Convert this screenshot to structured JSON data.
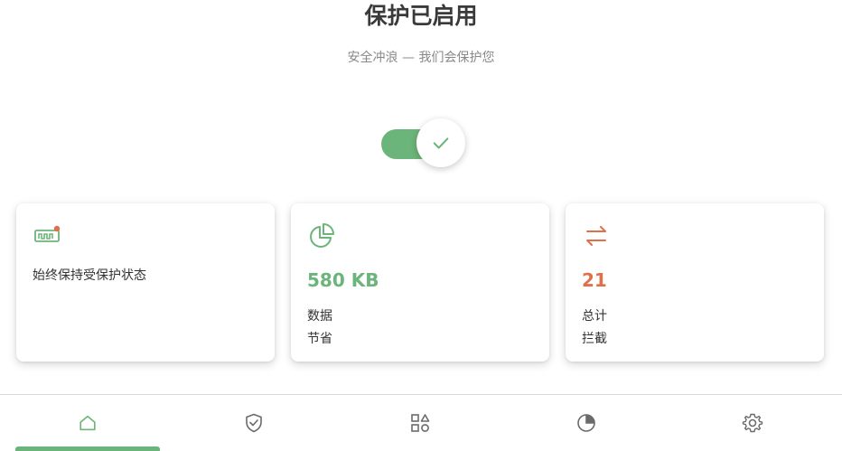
{
  "header": {
    "title": "保护已启用",
    "subtitle": "安全冲浪 — 我们会保护您"
  },
  "toggle": {
    "state": "on"
  },
  "colors": {
    "green": "#6cb57a",
    "orange": "#e0704a",
    "icon_gray": "#6b6b6b"
  },
  "cards": {
    "always": {
      "icon": "bandwidth-meter-icon",
      "text": "始终保持受保护状态"
    },
    "data": {
      "icon": "pie-chart-icon",
      "value": "580 KB",
      "line1": "数据",
      "line2": "节省"
    },
    "blocked": {
      "icon": "swap-arrows-icon",
      "value": "21",
      "line1": "总计",
      "line2": "拦截"
    }
  },
  "nav": {
    "items": [
      "home-icon",
      "shield-check-icon",
      "apps-icon",
      "pie-chart-icon",
      "settings-gear-icon"
    ],
    "active": 0
  }
}
